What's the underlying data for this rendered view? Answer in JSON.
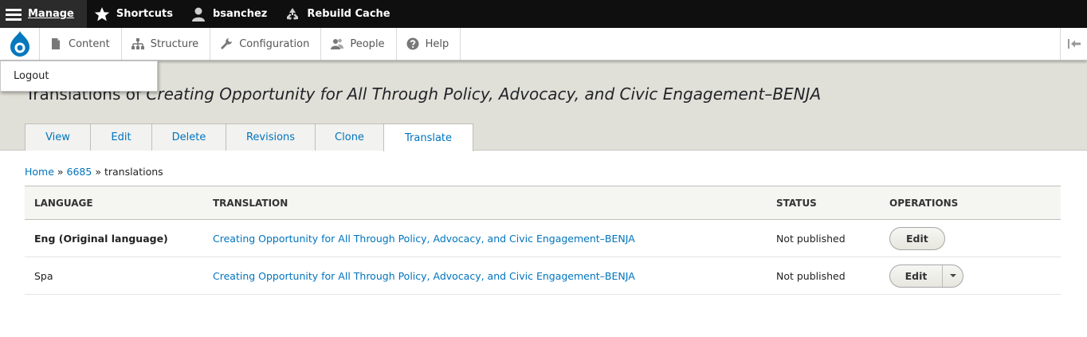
{
  "toolbar": {
    "manage": "Manage",
    "shortcuts": "Shortcuts",
    "user": "bsanchez",
    "rebuild_cache": "Rebuild Cache"
  },
  "tray": {
    "items": [
      {
        "label": "Content",
        "icon": "file-icon"
      },
      {
        "label": "Structure",
        "icon": "sitemap-icon"
      },
      {
        "label": "Configuration",
        "icon": "wrench-icon"
      },
      {
        "label": "People",
        "icon": "people-icon"
      },
      {
        "label": "Help",
        "icon": "help-icon"
      }
    ]
  },
  "user_menu": {
    "logout": "Logout"
  },
  "page": {
    "title_prefix": "Translations of ",
    "title_node": "Creating Opportunity for All Through Policy, Advocacy, and Civic Engagement–BENJA"
  },
  "tabs": [
    "View",
    "Edit",
    "Delete",
    "Revisions",
    "Clone",
    "Translate"
  ],
  "breadcrumb": {
    "home": "Home",
    "sep1": " » ",
    "node": "6685",
    "sep2": " » ",
    "current": "translations"
  },
  "table": {
    "headers": [
      "Language",
      "Translation",
      "Status",
      "Operations"
    ],
    "rows": [
      {
        "language": "Eng (Original language)",
        "translation": "Creating Opportunity for All Through Policy, Advocacy, and Civic Engagement–BENJA",
        "status": "Not published",
        "operation": "Edit"
      },
      {
        "language": "Spa",
        "translation": "Creating Opportunity for All Through Policy, Advocacy, and Civic Engagement–BENJA",
        "status": "Not published",
        "operation": "Edit"
      }
    ]
  },
  "colors": {
    "link": "#0074bd",
    "toolbar_bg": "#0f0f0f",
    "header_bg": "#e0e0d8",
    "drupal_blue": "#0678be"
  }
}
